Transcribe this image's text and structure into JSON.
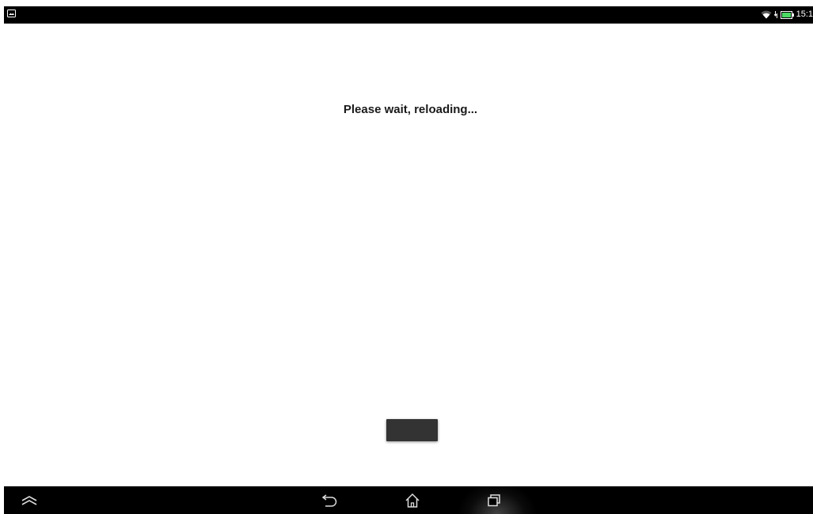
{
  "status_bar": {
    "time": "15:1",
    "notification_icon": "gallery-notification-icon",
    "wifi_icon": "wifi-icon",
    "signal_icon": "data-activity-icon",
    "battery_icon": "battery-icon"
  },
  "main": {
    "message": "Please wait, reloading...",
    "button_label": ""
  },
  "nav_bar": {
    "buttons": [
      {
        "name": "menu-up-icon"
      },
      {
        "name": "back-icon"
      },
      {
        "name": "home-icon"
      },
      {
        "name": "recent-apps-icon"
      }
    ]
  },
  "colors": {
    "status_bar_bg": "#000000",
    "nav_bar_bg": "#000000",
    "battery_green": "#4cd964",
    "button_bg": "#333333",
    "text": "#1a1a1a"
  }
}
